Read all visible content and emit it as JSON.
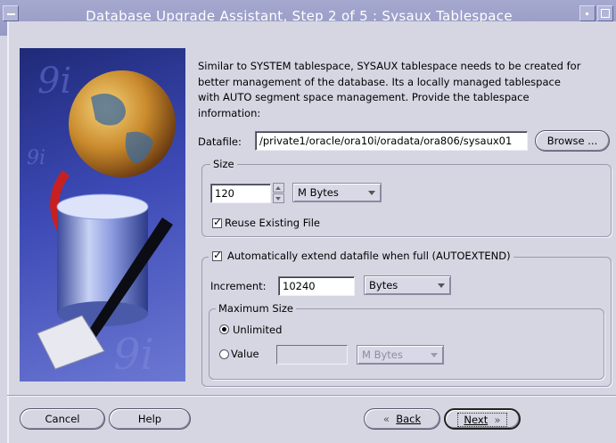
{
  "window": {
    "title": "Database Upgrade Assistant, Step 2 of 5 : Sysaux Tablespace"
  },
  "graphic": {
    "watermark": "9i"
  },
  "intro": {
    "text": "Similar to SYSTEM tablespace, SYSAUX tablespace needs to be created for better management of the database. Its a locally managed tablespace with AUTO segment space management. Provide the tablespace information:"
  },
  "datafile": {
    "label": "Datafile:",
    "value": "/private1/oracle/ora10i/oradata/ora806/sysaux01",
    "browse_label": "Browse ..."
  },
  "size": {
    "legend": "Size",
    "value": "120",
    "unit": "M Bytes",
    "reuse_label": "Reuse Existing File",
    "reuse_checked": true
  },
  "autoextend": {
    "label": "Automatically extend datafile when full (AUTOEXTEND)",
    "checked": true,
    "increment_label": "Increment:",
    "increment_value": "10240",
    "increment_unit": "Bytes",
    "maxsize": {
      "legend": "Maximum Size",
      "unlimited_label": "Unlimited",
      "unlimited_selected": true,
      "value_label": "Value",
      "value": "",
      "value_unit": "M Bytes"
    }
  },
  "buttons": {
    "cancel": "Cancel",
    "help": "Help",
    "back": "Back",
    "next": "Next"
  },
  "colors": {
    "titlebar": "#9a9ec8",
    "window_bg": "#d6d6e3",
    "graphic_bg": "#2e3a9a"
  }
}
